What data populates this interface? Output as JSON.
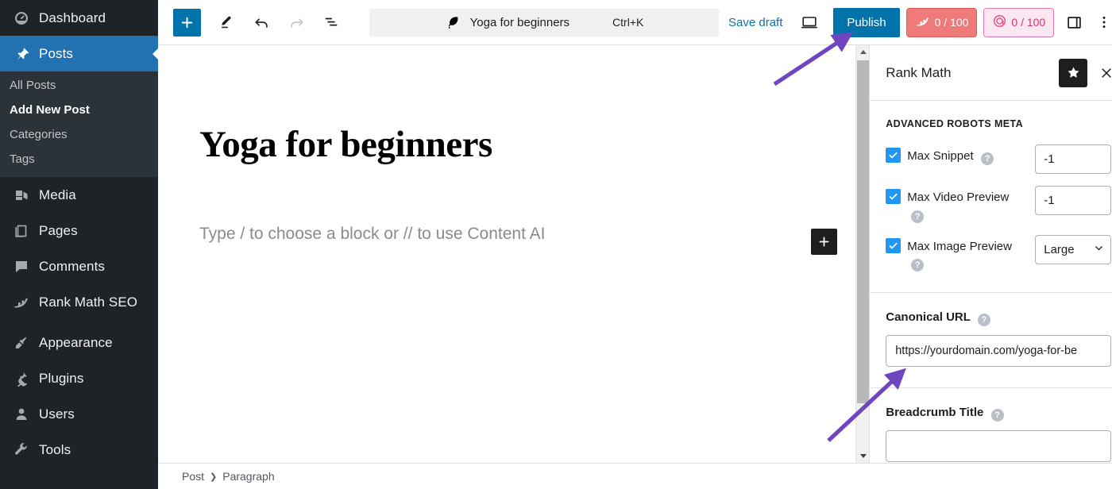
{
  "admin_menu": {
    "items": [
      {
        "label": "Dashboard",
        "icon": "dashboard-icon",
        "current": false
      },
      {
        "label": "Posts",
        "icon": "pin-icon",
        "current": true
      },
      {
        "label": "Media",
        "icon": "media-icon",
        "current": false
      },
      {
        "label": "Pages",
        "icon": "pages-icon",
        "current": false
      },
      {
        "label": "Comments",
        "icon": "comments-icon",
        "current": false
      },
      {
        "label": "Rank Math SEO",
        "icon": "rank-math-icon",
        "current": false
      },
      {
        "label": "Appearance",
        "icon": "appearance-icon",
        "current": false
      },
      {
        "label": "Plugins",
        "icon": "plugins-icon",
        "current": false
      },
      {
        "label": "Users",
        "icon": "users-icon",
        "current": false
      },
      {
        "label": "Tools",
        "icon": "tools-icon",
        "current": false
      }
    ],
    "posts_submenu": [
      {
        "label": "All Posts",
        "current": false
      },
      {
        "label": "Add New Post",
        "current": true
      },
      {
        "label": "Categories",
        "current": false
      },
      {
        "label": "Tags",
        "current": false
      }
    ]
  },
  "header": {
    "inserter_label": "+",
    "tools_icon": "pencil-icon",
    "undo_icon": "undo-icon",
    "redo_icon": "redo-icon",
    "list_view_icon": "document-overview-icon",
    "command_bar": {
      "icon": "feather-icon",
      "title": "Yoga for beginners",
      "shortcut": "Ctrl+K"
    },
    "save_draft_label": "Save draft",
    "preview_icon": "preview-desktop-icon",
    "publish_label": "Publish",
    "seo_score": "0 / 100",
    "seo_score_icon": "rank-math-icon",
    "ai_score": "0 / 100",
    "ai_score_icon": "content-ai-icon",
    "sidebar_toggle_icon": "settings-sidebar-icon",
    "more_menu_icon": "more-vertical-icon"
  },
  "editor": {
    "post_title": "Yoga for beginners",
    "paragraph_placeholder": "Type / to choose a block or // to use Content AI",
    "appender_label": "+"
  },
  "footer": {
    "breadcrumb": [
      "Post",
      "Paragraph"
    ],
    "separator": "›"
  },
  "rank_math": {
    "title": "Rank Math",
    "star_icon": "star-icon",
    "close_icon": "close-icon",
    "section_title": "ADVANCED ROBOTS META",
    "help_glyph": "?",
    "rows": [
      {
        "label": "Max Snippet",
        "checked": true,
        "control": "input",
        "value": "-1"
      },
      {
        "label": "Max Video Preview",
        "checked": true,
        "control": "input",
        "value": "-1"
      },
      {
        "label": "Max Image Preview",
        "checked": true,
        "control": "select",
        "value": "Large"
      }
    ],
    "canonical": {
      "label": "Canonical URL",
      "value": "https://yourdomain.com/yoga-for-be"
    },
    "breadcrumb": {
      "label": "Breadcrumb Title",
      "value": ""
    }
  },
  "colors": {
    "wp_blue": "#0173aa",
    "admin_bg": "#1d2327",
    "admin_submenu_bg": "#2c3338",
    "current_menu": "#2271b1",
    "seo_pill": "#ef7a7a",
    "ai_pill": "#fde8f1",
    "checkbox": "#2196f3",
    "annotation_arrow": "#7046c0"
  }
}
